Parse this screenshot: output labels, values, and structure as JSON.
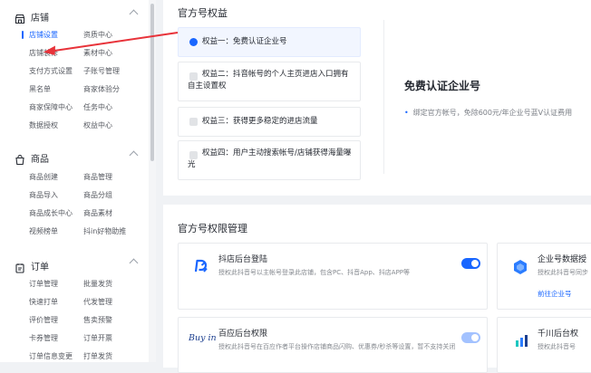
{
  "sidebar": {
    "sections": [
      {
        "title": "店铺",
        "icon": "store-icon",
        "items": [
          [
            "店铺设置",
            "资质中心"
          ],
          [
            "店铺装修",
            "素材中心"
          ],
          [
            "支付方式设置",
            "子账号管理"
          ],
          [
            "黑名单",
            "商家体验分"
          ],
          [
            "商家保障中心",
            "任务中心"
          ],
          [
            "数据授权",
            "权益中心"
          ]
        ],
        "active": "店铺设置"
      },
      {
        "title": "商品",
        "icon": "product-icon",
        "items": [
          [
            "商品创建",
            "商品管理"
          ],
          [
            "商品导入",
            "商品分组"
          ],
          [
            "商品成长中心",
            "商品素材"
          ],
          [
            "视频榜单",
            "抖in好物助推"
          ]
        ]
      },
      {
        "title": "订单",
        "icon": "order-icon",
        "items": [
          [
            "订单管理",
            "批量发货"
          ],
          [
            "快速打单",
            "代发管理"
          ],
          [
            "评价管理",
            "售卖预警"
          ],
          [
            "卡券管理",
            "订单开票"
          ],
          [
            "订单信息变更",
            "打单发货"
          ]
        ]
      }
    ]
  },
  "benefits": {
    "title": "官方号权益",
    "items": [
      {
        "label": "权益一：免费认证企业号",
        "active": true
      },
      {
        "label": "权益二：抖音帐号的个人主页进店入口拥有自主设置权",
        "active": false
      },
      {
        "label": "权益三：获得更多稳定的进店流量",
        "active": false
      },
      {
        "label": "权益四：用户主动搜索帐号/店铺获得海量曝光",
        "active": false
      }
    ],
    "detail": {
      "title": "免费认证企业号",
      "desc": "绑定官方帐号，免除600元/年企业号蓝V认证费用"
    }
  },
  "permissions": {
    "title": "官方号权限管理",
    "items": [
      {
        "title": "抖店后台登陆",
        "desc": "授权此抖音号以主帐号登录此店铺，包含PC、抖音App、抖店APP等",
        "toggle": "on",
        "logo": "doudian-logo-icon"
      },
      {
        "title": "企业号数据授",
        "desc": "授权此抖音号同步",
        "link": "前往企业号",
        "logo": "enterprise-logo-icon"
      },
      {
        "title": "百应后台权限",
        "desc": "授权此抖音号在百应作者平台操作店铺商品闪购、优惠券/秒杀等设置，暂不支持关闭",
        "toggle": "disabled",
        "logo_text": "Buy in"
      },
      {
        "title": "千川后台权",
        "desc": "授权此抖音号",
        "logo": "qianchuan-logo-icon"
      }
    ]
  },
  "colors": {
    "accent": "#1966ff",
    "annotation_arrow": "#e8333a"
  }
}
